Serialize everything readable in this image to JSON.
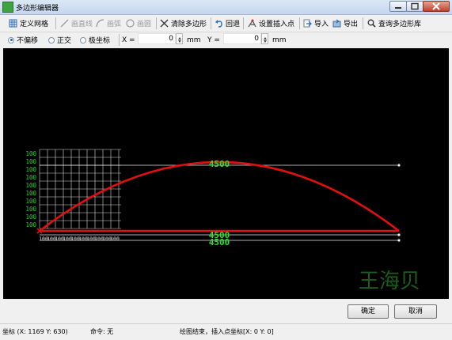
{
  "window": {
    "title": "多边形编辑器"
  },
  "toolbar": {
    "define_grid": "定义网格",
    "draw_line": "画直线",
    "draw_arc": "画弧",
    "draw_circle": "画圆",
    "clear_polygon": "清除多边形",
    "undo": "回退",
    "set_insert_point": "设置插入点",
    "import": "导入",
    "export": "导出",
    "query_library": "查询多边形库"
  },
  "options": {
    "mode_no_offset": "不偏移",
    "mode_orthogonal": "正交",
    "mode_polar": "极坐标",
    "selected_mode": "不偏移",
    "x_label": "X =",
    "x_value": "0",
    "x_unit": "mm",
    "y_label": "Y =",
    "y_value": "0",
    "y_unit": "mm"
  },
  "canvas": {
    "grid_row_labels": [
      "100",
      "100",
      "100",
      "100",
      "100",
      "100",
      "100",
      "100",
      "100",
      "100"
    ],
    "grid_col_labels": [
      "100",
      "100",
      "100",
      "100",
      "100",
      "100",
      "100",
      "100",
      "100",
      "100"
    ],
    "dim_top": "4500",
    "dim_mid": "4500",
    "dim_bottom": "4500",
    "watermark": "王海贝",
    "colors": {
      "background": "#000000",
      "grid": "#ffffff",
      "grid_label": "#33cc33",
      "shape": "#e01010",
      "dimension": "#33dd33"
    }
  },
  "buttons": {
    "ok": "确定",
    "cancel": "取消"
  },
  "status": {
    "coords": "坐标 (X: 1169 Y: 630)",
    "command": "命令: 无",
    "message": "绘图结束，插入点坐标[X: 0 Y: 0]"
  }
}
